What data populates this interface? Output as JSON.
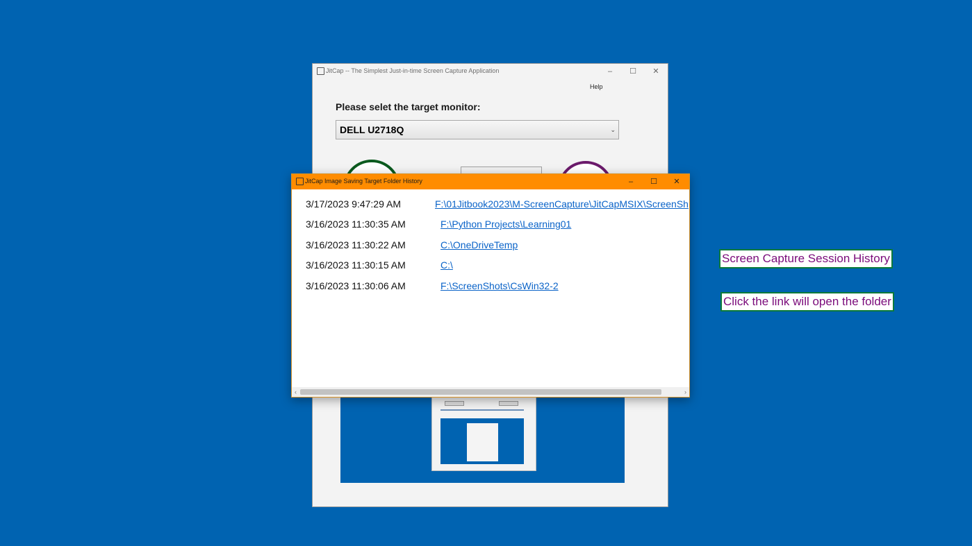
{
  "main_window": {
    "title": "JitCap -- The Simplest Just-in-time Screen Capture Application",
    "menu_help": "Help",
    "monitor_label": "Please selet the target monitor:",
    "monitor_selected": "DELL U2718Q",
    "controls": {
      "minimize": "–",
      "maximize": "☐",
      "close": "✕"
    }
  },
  "history_window": {
    "title": "JitCap Image Saving Target Folder History",
    "controls": {
      "minimize": "–",
      "maximize": "☐",
      "close": "✕"
    },
    "rows": [
      {
        "time": "3/17/2023 9:47:29 AM",
        "path": "F:\\01Jitbook2023\\M-ScreenCapture\\JitCapMSIX\\ScreenSh"
      },
      {
        "time": "3/16/2023 11:30:35 AM",
        "path": "F:\\Python Projects\\Learning01"
      },
      {
        "time": "3/16/2023 11:30:22 AM",
        "path": "C:\\OneDriveTemp"
      },
      {
        "time": "3/16/2023 11:30:15 AM",
        "path": "C:\\"
      },
      {
        "time": "3/16/2023 11:30:06 AM",
        "path": "F:\\ScreenShots\\CsWin32-2"
      }
    ]
  },
  "annotations": {
    "session_history": "Screen Capture Session History",
    "click_link": "Click the link will open the folder"
  },
  "colors": {
    "desktop": "#0063B1",
    "history_titlebar": "#FF8C00",
    "link": "#0A63C8",
    "annotation_text": "#7A0A7A",
    "annotation_border": "#0B7A3A"
  }
}
